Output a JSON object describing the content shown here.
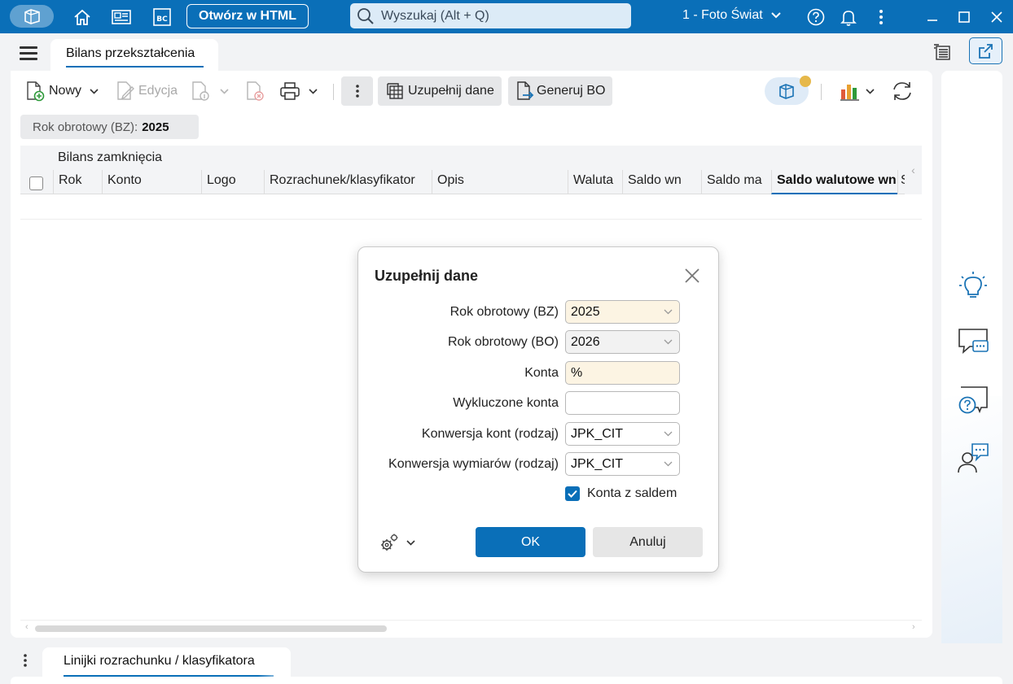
{
  "titlebar": {
    "open_html_label": "Otwórz w HTML",
    "search_placeholder": "Wyszukaj (Alt + Q)",
    "company": "1 - Foto Świat"
  },
  "tabs": {
    "main_tab": "Bilans przekształcenia",
    "bottom_tab": "Linijki rozrachunku / klasyfikatora"
  },
  "toolbar": {
    "new_label": "Nowy",
    "edit_label": "Edycja",
    "complete_data_label": "Uzupełnij dane",
    "generate_bo_label": "Generuj BO"
  },
  "filter": {
    "label": "Rok obrotowy (BZ):",
    "value": "2025"
  },
  "grid": {
    "group_header": "Bilans zamknięcia",
    "columns": [
      {
        "label": "Rok"
      },
      {
        "label": "Konto"
      },
      {
        "label": "Logo"
      },
      {
        "label": "Rozrachunek/klasyfikator"
      },
      {
        "label": "Opis"
      },
      {
        "label": "Waluta"
      },
      {
        "label": "Saldo wn"
      },
      {
        "label": "Saldo ma"
      },
      {
        "label": "Saldo walutowe wn"
      },
      {
        "label": "S"
      }
    ]
  },
  "dialog": {
    "title": "Uzupełnij dane",
    "fields": [
      {
        "label": "Rok obrotowy (BZ)",
        "value": "2025"
      },
      {
        "label": "Rok obrotowy (BO)",
        "value": "2026"
      },
      {
        "label": "Konta",
        "value": "%"
      },
      {
        "label": "Wykluczone konta",
        "value": ""
      },
      {
        "label": "Konwersja kont (rodzaj)",
        "value": "JPK_CIT"
      },
      {
        "label": "Konwersja wymiarów (rodzaj)",
        "value": "JPK_CIT"
      }
    ],
    "checkbox_label": "Konta z saldem",
    "ok_label": "OK",
    "cancel_label": "Anuluj"
  },
  "colors": {
    "accent": "#0a6fb8",
    "required_field": "#fcf4e3"
  }
}
